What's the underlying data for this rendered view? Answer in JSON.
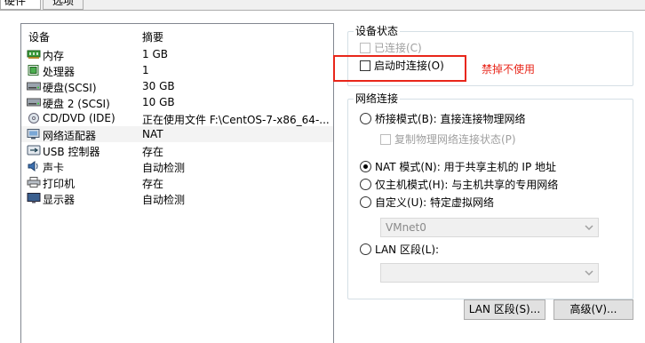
{
  "tabs": [
    {
      "label": "硬件"
    },
    {
      "label": "选项"
    }
  ],
  "device_list": {
    "columns": [
      "设备",
      "摘要"
    ],
    "rows": [
      {
        "name": "内存",
        "summary": "1 GB",
        "icon": "memory-icon"
      },
      {
        "name": "处理器",
        "summary": "1",
        "icon": "processor-icon"
      },
      {
        "name": "硬盘(SCSI)",
        "summary": "30 GB",
        "icon": "hard-disk-icon"
      },
      {
        "name": "硬盘 2 (SCSI)",
        "summary": "10 GB",
        "icon": "hard-disk-icon"
      },
      {
        "name": "CD/DVD (IDE)",
        "summary": "正在使用文件 F:\\CentOS-7-x86_64-...",
        "icon": "cd-dvd-icon"
      },
      {
        "name": "网络适配器",
        "summary": "NAT",
        "icon": "network-adapter-icon",
        "selected": true
      },
      {
        "name": "USB 控制器",
        "summary": "存在",
        "icon": "usb-controller-icon"
      },
      {
        "name": "声卡",
        "summary": "自动检测",
        "icon": "sound-card-icon"
      },
      {
        "name": "打印机",
        "summary": "存在",
        "icon": "printer-icon"
      },
      {
        "name": "显示器",
        "summary": "自动检测",
        "icon": "display-icon"
      }
    ]
  },
  "device_status": {
    "title": "设备状态",
    "connected_label": "已连接(C)",
    "connect_on_start_label": "启动时连接(O)",
    "annotation": "禁掉不使用",
    "annotation_color": "#e8261a"
  },
  "network_connection": {
    "title": "网络连接",
    "bridged_label": "桥接模式(B): 直接连接物理网络",
    "replicate_label": "复制物理网络连接状态(P)",
    "nat_label": "NAT 模式(N): 用于共享主机的 IP 地址",
    "hostonly_label": "仅主机模式(H): 与主机共享的专用网络",
    "custom_label": "自定义(U): 特定虚拟网络",
    "custom_value": "VMnet0",
    "lan_label": "LAN 区段(L):",
    "lan_value": "",
    "selected": "nat"
  },
  "buttons": {
    "lan_segments": "LAN 区段(S)...",
    "advanced": "高级(V)..."
  }
}
